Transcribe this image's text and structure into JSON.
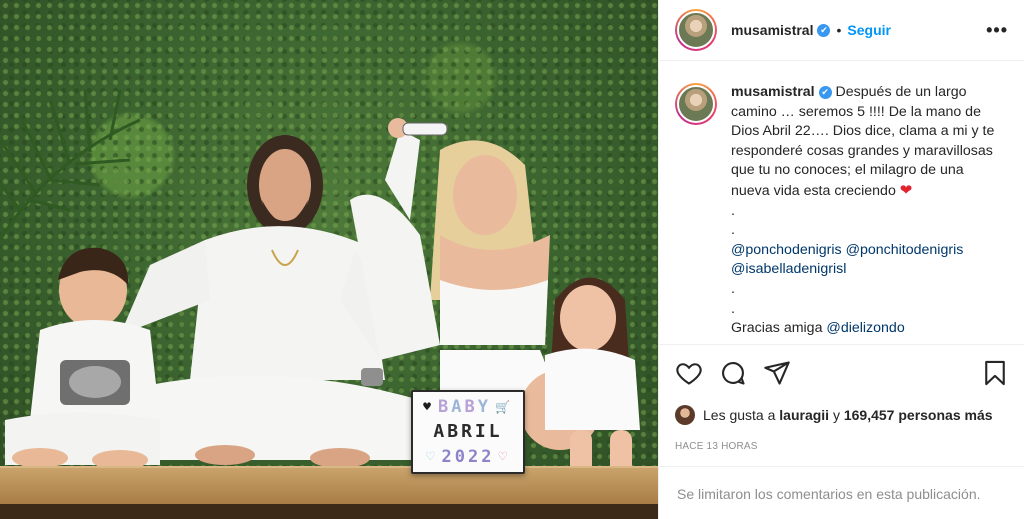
{
  "post": {
    "username": "musamistral",
    "verified_mark": "✔",
    "separator": "•",
    "follow_label": "Seguir",
    "more_label": "•••",
    "caption": {
      "username": "musamistral",
      "text": "Después de un largo camino … seremos 5 !!!! De la mano de Dios Abril 22…. Dios dice, clama a mi y te responderé cosas grandes y maravillosas que tu no conoces; el milagro de una nueva vida esta creciendo",
      "heart_emoji": "❤",
      "dot1": ".",
      "dot2": ".",
      "mentions_line1": [
        "@ponchodenigris",
        "@ponchitodenigris"
      ],
      "mentions_line2": "@isabelladenigrisl",
      "dot3": ".",
      "dot4": ".",
      "thanks_text": "Gracias amiga",
      "thanks_mention": "@dielizondo"
    },
    "likes": {
      "prefix": "Les gusta a",
      "user": "lauragii",
      "connector": "y",
      "count_text": "169,457 personas más"
    },
    "timestamp": "HACE 13 HORAS",
    "comments_closed": "Se limitaron los comentarios en esta publicación."
  },
  "lightbox": {
    "row1": [
      "B",
      "A",
      "B",
      "Y"
    ],
    "row2": "ABRIL",
    "row3": "2022",
    "icons": [
      "heart-black",
      "stroller",
      "heart-outline",
      "heart-pink"
    ]
  },
  "colors": {
    "link_blue": "#0095f6",
    "mention_blue": "#00376b",
    "verified_blue": "#3897f0",
    "muted_gray": "#8e8e8e",
    "heart_red": "#e0232e"
  }
}
